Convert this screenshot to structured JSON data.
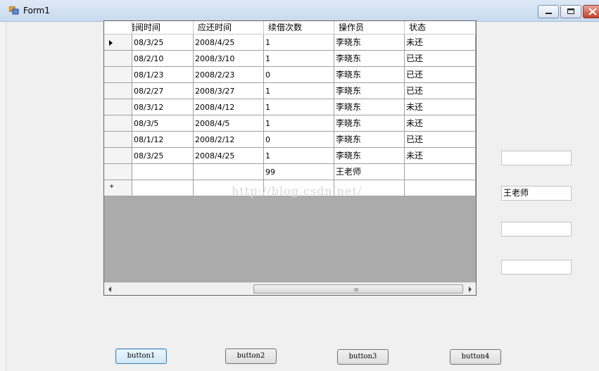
{
  "window": {
    "title": "Form1"
  },
  "grid": {
    "columns": [
      "借阅时间",
      "应还时间",
      "续借次数",
      "操作员",
      "状态"
    ],
    "rows": [
      [
        "08/3/25",
        "2008/4/25",
        "1",
        "李晓东",
        "未还"
      ],
      [
        "08/2/10",
        "2008/3/10",
        "1",
        "李晓东",
        "已还"
      ],
      [
        "08/1/23",
        "2008/2/23",
        "0",
        "李晓东",
        "已还"
      ],
      [
        "08/2/27",
        "2008/3/27",
        "1",
        "李晓东",
        "已还"
      ],
      [
        "08/3/12",
        "2008/4/12",
        "1",
        "李晓东",
        "未还"
      ],
      [
        "08/3/5",
        "2008/4/5",
        "1",
        "李晓东",
        "未还"
      ],
      [
        "08/1/12",
        "2008/2/12",
        "0",
        "李晓东",
        "已还"
      ],
      [
        "08/3/25",
        "2008/4/25",
        "1",
        "李晓东",
        "未还"
      ],
      [
        "",
        "",
        "99",
        "王老师",
        ""
      ]
    ],
    "new_row_marker": "*",
    "scroll_grip": "III"
  },
  "watermark": "http://blog.csdn.net/",
  "textboxes": [
    "",
    "王老师",
    "",
    ""
  ],
  "buttons": {
    "button1": "button1",
    "button2": "button2",
    "button3": "button3",
    "button4": "button4"
  }
}
